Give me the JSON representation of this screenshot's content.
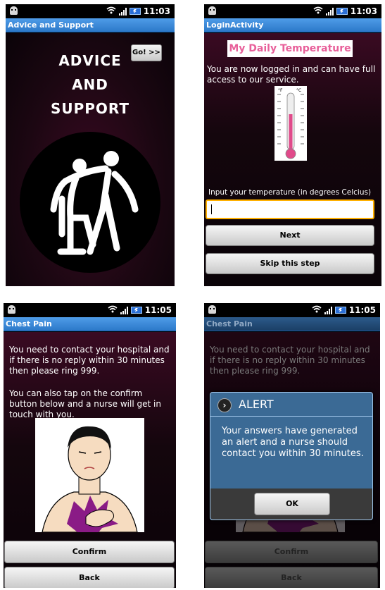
{
  "status": {
    "time_1": "11:03",
    "time_2": "11:03",
    "time_3": "11:05",
    "time_4": "11:05"
  },
  "screen1": {
    "title": "Advice and Support",
    "headline_1": "ADVICE",
    "headline_2": "AND",
    "headline_3": "SUPPORT",
    "go_label": "Go! >>"
  },
  "screen2": {
    "title": "LoginActivity",
    "header": "My Daily Temperature",
    "message": "You are now logged in and can have full access to our service.",
    "unit_f": "°F",
    "unit_c": "°C",
    "input_label": "Input your temperature (in degrees Celcius)",
    "input_value": "",
    "next_label": "Next",
    "skip_label": "Skip this step"
  },
  "screen3": {
    "title": "Chest Pain",
    "text_1": "You need to contact your hospital and if there is no reply within 30 minutes then please ring 999.",
    "text_2": "You can also tap on the confirm button below and a nurse will get in   touch with you.",
    "confirm_label": "Confirm",
    "back_label": "Back"
  },
  "screen4": {
    "title": "Chest Pain",
    "text_1": "You need to contact your hospital and if there is no reply within 30 minutes then please ring 999.",
    "confirm_label": "Confirm",
    "back_label": "Back",
    "dialog": {
      "icon": "chevron-right-icon",
      "title": "ALERT",
      "message": "Your answers have generated an alert and a nurse should contact you within 30 minutes.",
      "ok_label": "OK"
    }
  }
}
